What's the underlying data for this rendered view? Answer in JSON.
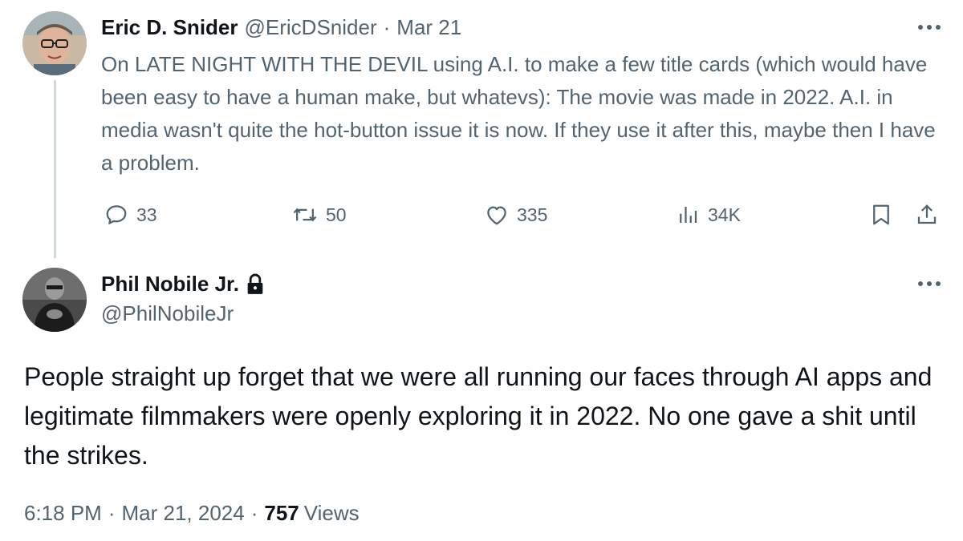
{
  "parent_tweet": {
    "author_name": "Eric D. Snider",
    "handle": "@EricDSnider",
    "separator": "·",
    "date": "Mar 21",
    "text": "On LATE NIGHT WITH THE DEVIL using A.I. to make a few title cards (which would have been easy to have a human make, but whatevs): The movie was made in 2022. A.I. in media wasn't quite the hot-button issue it is now. If they use it after this, maybe then I have a problem.",
    "replies": "33",
    "retweets": "50",
    "likes": "335",
    "views": "34K"
  },
  "reply_tweet": {
    "author_name": "Phil Nobile Jr.",
    "handle": "@PhilNobileJr",
    "text": "People straight up forget that we were all running our faces through AI apps and legitimate filmmakers were openly exploring it in 2022. No one gave a shit until the strikes.",
    "time": "6:18 PM",
    "separator": "·",
    "date": "Mar 21, 2024",
    "views_count": "757",
    "views_label": "Views"
  },
  "icons": {
    "more": "more-horizontal-icon",
    "reply": "reply-bubble-icon",
    "retweet": "retweet-icon",
    "like": "heart-icon",
    "views": "bar-chart-icon",
    "bookmark": "bookmark-icon",
    "share": "share-upload-icon",
    "lock": "lock-icon"
  },
  "colors": {
    "text_primary": "#0f1419",
    "text_secondary": "#536471",
    "thread_line": "#cfd9de"
  }
}
